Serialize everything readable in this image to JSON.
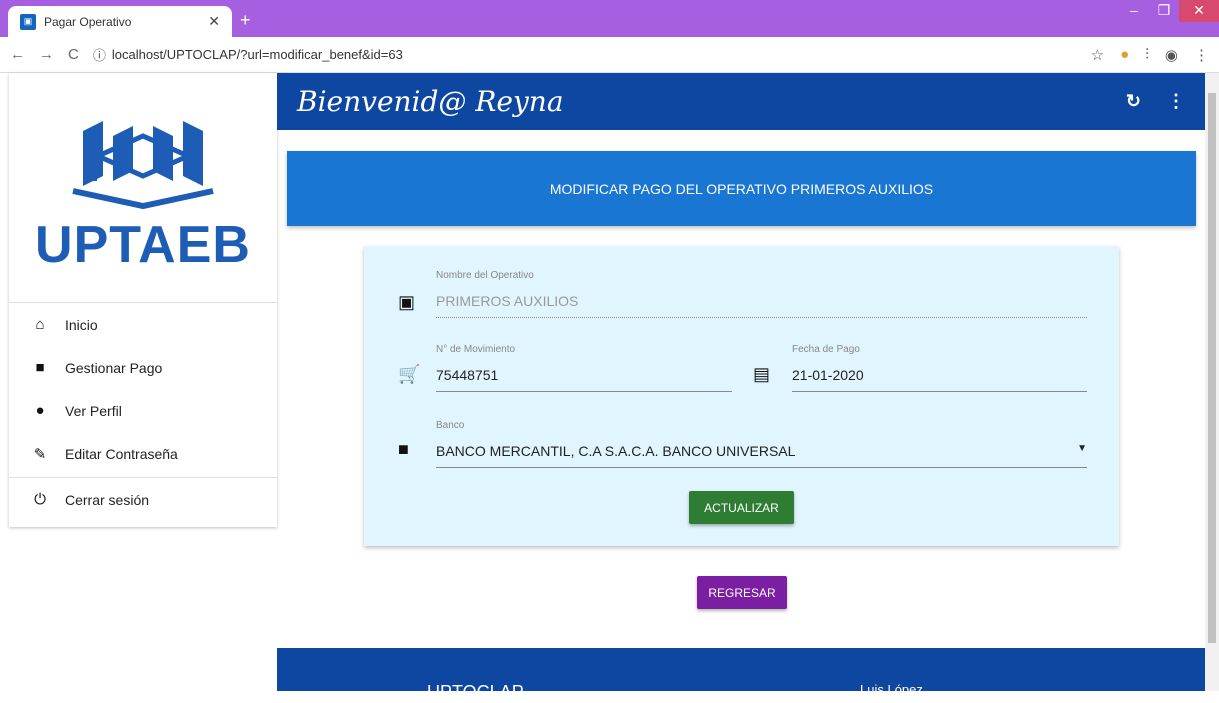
{
  "browser": {
    "tab_title": "Pagar Operativo",
    "url": "localhost/UPTOCLAP/?url=modificar_benef&id=63"
  },
  "sidebar": {
    "logo_text": "UPTAEB",
    "items": [
      {
        "label": "Inicio",
        "icon": "home-icon"
      },
      {
        "label": "Gestionar Pago",
        "icon": "briefcase-icon"
      },
      {
        "label": "Ver Perfil",
        "icon": "person-icon"
      },
      {
        "label": "Editar Contraseña",
        "icon": "pencil-icon"
      }
    ],
    "logout": {
      "label": "Cerrar sesión",
      "icon": "power-icon"
    }
  },
  "header": {
    "title": "Bienvenid@ Reyna"
  },
  "banner": {
    "text": "MODIFICAR PAGO DEL OPERATIVO PRIMEROS AUXILIOS"
  },
  "form": {
    "operativo": {
      "label": "Nombre del Operativo",
      "value": "PRIMEROS AUXILIOS"
    },
    "movimiento": {
      "label": "N° de Movimiento",
      "value": "75448751"
    },
    "fecha": {
      "label": "Fecha de Pago",
      "value": "21-01-2020"
    },
    "banco": {
      "label": "Banco",
      "value": "BANCO MERCANTIL, C.A S.A.C.A. BANCO UNIVERSAL"
    },
    "submit_label": "ACTUALIZAR"
  },
  "back_label": "REGRESAR",
  "footer": {
    "left": "UPTOCLAP",
    "right": "Luis López"
  }
}
